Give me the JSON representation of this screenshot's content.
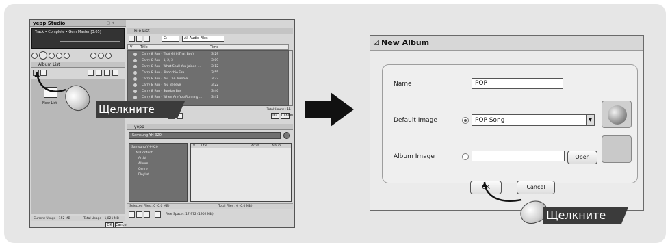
{
  "colors": {
    "background": "#e6e6e6",
    "arrow": "#111111",
    "callout": "#3b3b3b",
    "callout_text": "#ffffff"
  },
  "left_screenshot": {
    "app_title": "yepp Studio",
    "player_text": "Track • Complete • Gem Master [3:05]",
    "file_list_title": "File List",
    "file_list_select": "All Audio Files",
    "file_list_columns": {
      "check": "V",
      "title": "Title",
      "time": "Time"
    },
    "file_list_rows": [
      {
        "title": "Carry & Ron - That Girl (That Boy)",
        "time": "3:29"
      },
      {
        "title": "Carry & Ron - 1, 2, 3",
        "time": "3:09"
      },
      {
        "title": "Carry & Ron - What Shall You Joined ...",
        "time": "3:12"
      },
      {
        "title": "Carry & Ron - Pinocchio Fire",
        "time": "3:55"
      },
      {
        "title": "Carry & Ron - You Can Tumble",
        "time": "3:22"
      },
      {
        "title": "Carry & Ron - You Believe",
        "time": "3:22"
      },
      {
        "title": "Carry & Ron - Sunday Bus",
        "time": "3:46"
      },
      {
        "title": "Carry & Ron - When Are You Running ...",
        "time": "3:41"
      }
    ],
    "total_count": "Total Count : 11",
    "album_list_title": "Album List",
    "new_list_label": "New List",
    "album_status_left": "Current Usage : 152 MB",
    "album_status_right": "Total Usage : 1,821 MB",
    "mp3_title": "yepp",
    "mp3_device": "Samsung YH-920",
    "tree_items": [
      "Samsung YH-920",
      "All Content",
      "Artist",
      "Album",
      "Genre",
      "Playlist"
    ],
    "table_columns": {
      "check": "V",
      "title": "Title",
      "artist": "Artist",
      "album": "Album"
    },
    "mp3_status_left": "Selected Files : 0 (0.0 MB)",
    "mp3_status_right": "Total Files : 0 (0.0 MB)",
    "ok_label": "OK",
    "cancel_label": "Cancel",
    "bottom_usage": "Free Space : 17,972 (1902 MB)"
  },
  "callout_left": {
    "text": "Щелкните"
  },
  "dialog": {
    "title": "New Album",
    "name_label": "Name",
    "name_value": "POP",
    "default_image_label": "Default Image",
    "default_image_value": "POP Song",
    "album_image_label": "Album Image",
    "album_image_value": "",
    "open_button": "Open",
    "ok_button": "OK",
    "cancel_button": "Cancel",
    "default_image_selected": true
  },
  "callout_right": {
    "text": "Щелкните"
  }
}
